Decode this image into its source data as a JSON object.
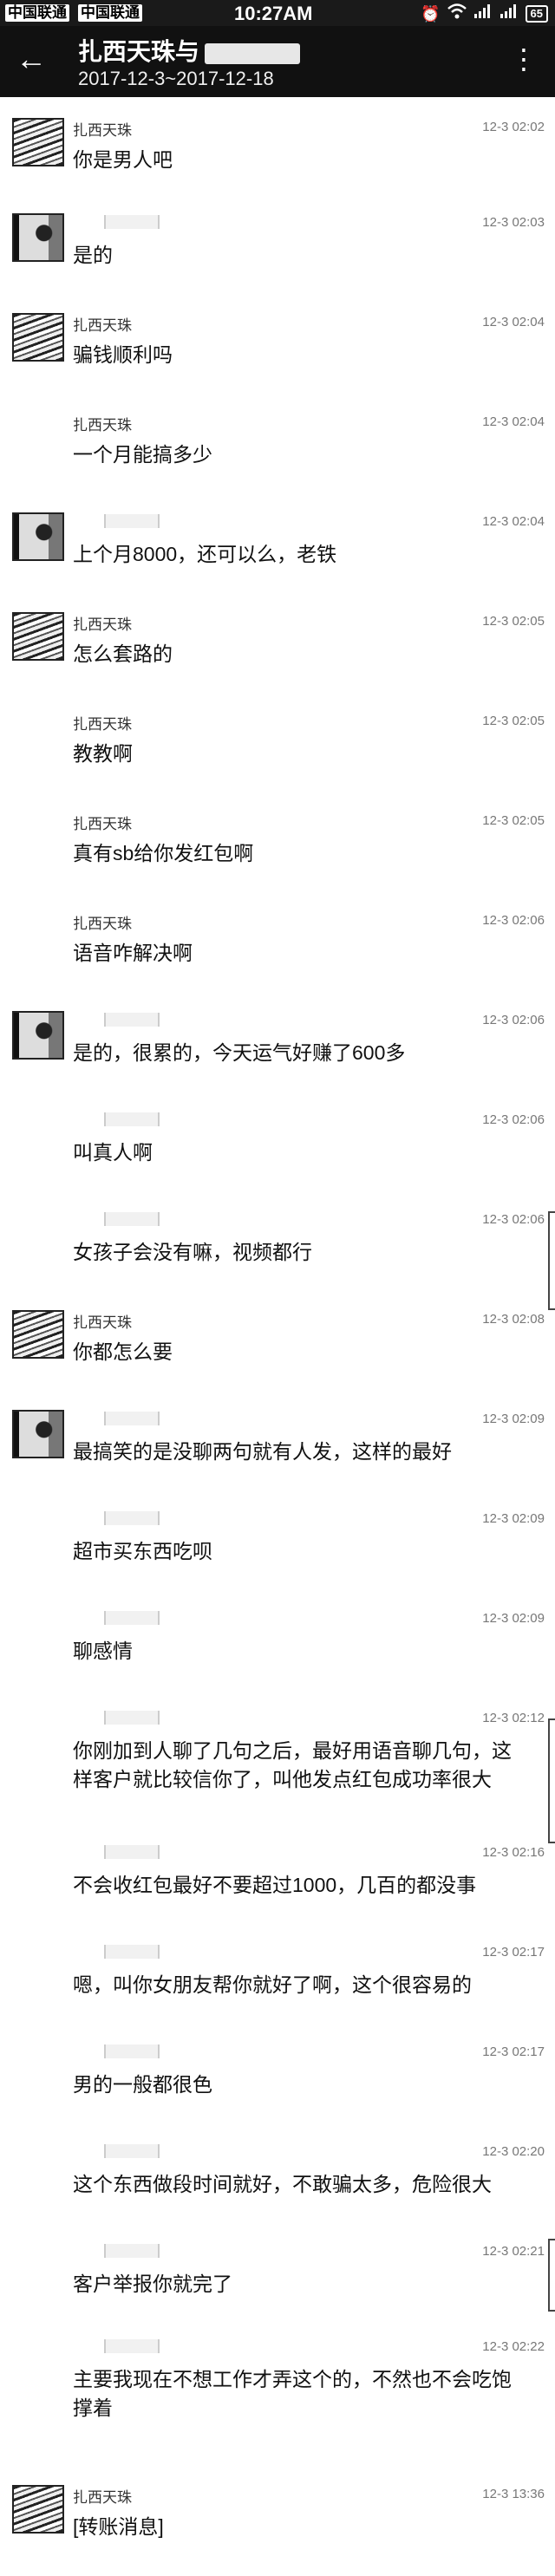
{
  "status_bar": {
    "carrier1": "中国联通",
    "carrier2": "中国联通",
    "time": "10:27AM",
    "battery": "65",
    "icons": [
      "alarm-icon",
      "wifi-icon",
      "signal-icon",
      "signal-icon",
      "battery-icon"
    ]
  },
  "header": {
    "title": "扎西天珠与",
    "title_redacted_suffix": "",
    "date_range": "2017-12-3~2017-12-18",
    "back_icon": "←",
    "more_icon": "⋮"
  },
  "messages": [
    {
      "sender": "扎西天珠",
      "time": "12-3 02:02",
      "text": "你是男人吧"
    },
    {
      "sender": "",
      "time": "12-3 02:03",
      "text": "是的"
    },
    {
      "sender": "扎西天珠",
      "time": "12-3 02:04",
      "text": "骗钱顺利吗"
    },
    {
      "sender": "扎西天珠",
      "time": "12-3 02:04",
      "text": "一个月能搞多少"
    },
    {
      "sender": "",
      "time": "12-3 02:04",
      "text": "上个月8000，还可以么，老铁"
    },
    {
      "sender": "扎西天珠",
      "time": "12-3 02:05",
      "text": "怎么套路的"
    },
    {
      "sender": "扎西天珠",
      "time": "12-3 02:05",
      "text": "教教啊"
    },
    {
      "sender": "扎西天珠",
      "time": "12-3 02:05",
      "text": "真有sb给你发红包啊"
    },
    {
      "sender": "扎西天珠",
      "time": "12-3 02:06",
      "text": "语音咋解决啊"
    },
    {
      "sender": "",
      "time": "12-3 02:06",
      "text": "是的，很累的，今天运气好赚了600多"
    },
    {
      "sender": "",
      "time": "12-3 02:06",
      "text": "叫真人啊"
    },
    {
      "sender": "",
      "time": "12-3 02:06",
      "text": "女孩子会没有嘛，视频都行"
    },
    {
      "sender": "扎西天珠",
      "time": "12-3 02:08",
      "text": "你都怎么要"
    },
    {
      "sender": "",
      "time": "12-3 02:09",
      "text": "最搞笑的是没聊两句就有人发，这样的最好"
    },
    {
      "sender": "",
      "time": "12-3 02:09",
      "text": "超市买东西吃呗"
    },
    {
      "sender": "",
      "time": "12-3 02:09",
      "text": "聊感情"
    },
    {
      "sender": "",
      "time": "12-3 02:12",
      "text": "你刚加到人聊了几句之后，最好用语音聊几句，这样客户就比较信你了，叫他发点红包成功率很大"
    },
    {
      "sender": "",
      "time": "12-3 02:16",
      "text": "不会收红包最好不要超过1000，几百的都没事"
    },
    {
      "sender": "",
      "time": "12-3 02:17",
      "text": "嗯，叫你女朋友帮你就好了啊，这个很容易的"
    },
    {
      "sender": "",
      "time": "12-3 02:17",
      "text": "男的一般都很色"
    },
    {
      "sender": "",
      "time": "12-3 02:20",
      "text": "这个东西做段时间就好，不敢骗太多，危险很大"
    },
    {
      "sender": "",
      "time": "12-3 02:21",
      "text": "客户举报你就完了"
    },
    {
      "sender": "",
      "time": "12-3 02:22",
      "text": "主要我现在不想工作才弄这个的，不然也不会吃饱撑着"
    },
    {
      "sender": "扎西天珠",
      "time": "12-3 13:36",
      "text": "[转账消息]"
    }
  ]
}
